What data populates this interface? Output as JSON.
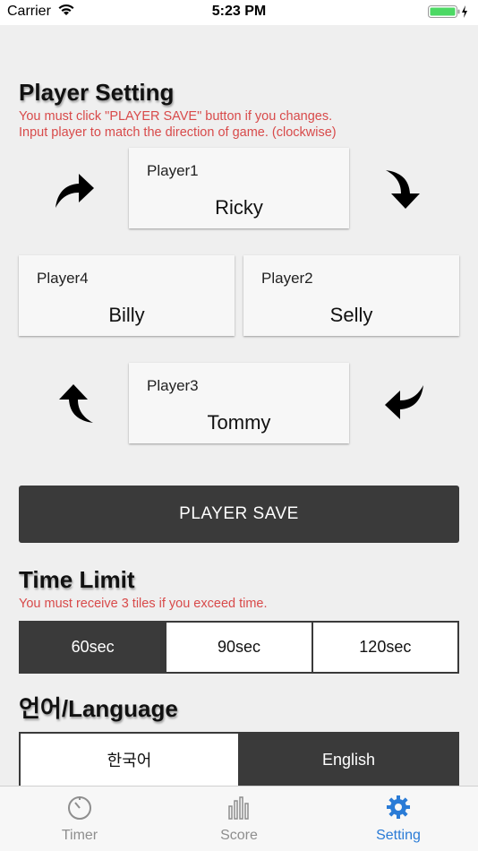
{
  "status_bar": {
    "carrier": "Carrier",
    "time": "5:23 PM"
  },
  "player_section": {
    "title": "Player Setting",
    "warning_1": "You must click \"PLAYER SAVE\" button if you changes.",
    "warning_2": "Input player to match the direction of game. (clockwise)",
    "players": [
      {
        "label": "Player1",
        "name": "Ricky"
      },
      {
        "label": "Player2",
        "name": "Selly"
      },
      {
        "label": "Player3",
        "name": "Tommy"
      },
      {
        "label": "Player4",
        "name": "Billy"
      }
    ],
    "save_label": "PLAYER SAVE"
  },
  "time_limit": {
    "title": "Time Limit",
    "warning": "You must receive 3 tiles if you exceed time.",
    "options": [
      "60sec",
      "90sec",
      "120sec"
    ],
    "selected": "60sec"
  },
  "language": {
    "title": "언어/Language",
    "options": [
      "한국어",
      "English"
    ],
    "selected": "English"
  },
  "tab_bar": {
    "tabs": [
      {
        "label": "Timer",
        "icon": "stopwatch-icon"
      },
      {
        "label": "Score",
        "icon": "bar-chart-icon"
      },
      {
        "label": "Setting",
        "icon": "gear-icon"
      }
    ],
    "active": "Setting"
  },
  "colors": {
    "accent": "#2a7bd6",
    "warning": "#d84a4a",
    "dark": "#3a3a3a"
  }
}
